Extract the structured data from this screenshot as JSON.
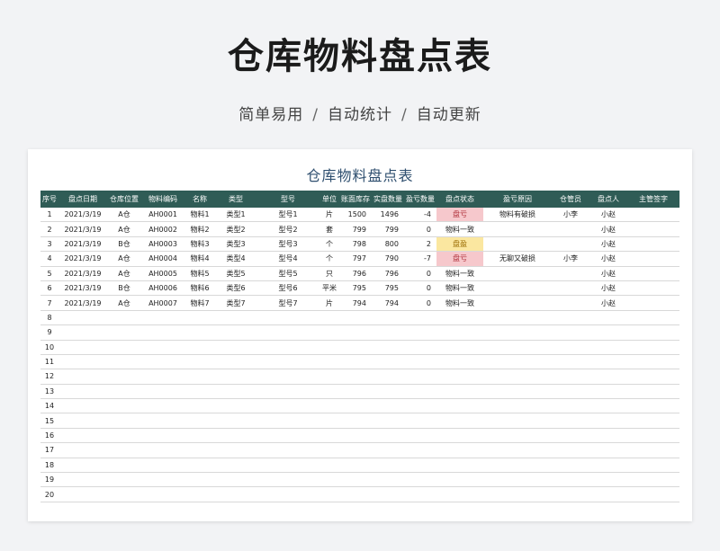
{
  "hero": {
    "title": "仓库物料盘点表",
    "subtitle_parts": [
      "简单易用",
      "自动统计",
      "自动更新"
    ],
    "separator": "/"
  },
  "sheet": {
    "title": "仓库物料盘点表",
    "header_color": "#2f5c56",
    "columns": [
      "序号",
      "盘点日期",
      "仓库位置",
      "物料编码",
      "名称",
      "类型",
      "型号",
      "单位",
      "账面库存",
      "实盘数量",
      "盈亏数量",
      "盘点状态",
      "盈亏原因",
      "仓管员",
      "盘点人",
      "主管签字"
    ],
    "rows": [
      {
        "seq": "1",
        "date": "2021/3/19",
        "location": "A仓",
        "code": "AH0001",
        "name": "物料1",
        "type": "类型1",
        "model": "型号1",
        "unit": "片",
        "book": "1500",
        "actual": "1496",
        "diff": "-4",
        "status": "盘亏",
        "status_kind": "loss",
        "reason": "物料有破损",
        "keeper": "小李",
        "checker": "小赵",
        "supervisor": ""
      },
      {
        "seq": "2",
        "date": "2021/3/19",
        "location": "A仓",
        "code": "AH0002",
        "name": "物料2",
        "type": "类型2",
        "model": "型号2",
        "unit": "套",
        "book": "799",
        "actual": "799",
        "diff": "0",
        "status": "物料一致",
        "status_kind": "ok",
        "reason": "",
        "keeper": "",
        "checker": "小赵",
        "supervisor": ""
      },
      {
        "seq": "3",
        "date": "2021/3/19",
        "location": "B仓",
        "code": "AH0003",
        "name": "物料3",
        "type": "类型3",
        "model": "型号3",
        "unit": "个",
        "book": "798",
        "actual": "800",
        "diff": "2",
        "status": "盘盈",
        "status_kind": "gain",
        "reason": "",
        "keeper": "",
        "checker": "小赵",
        "supervisor": ""
      },
      {
        "seq": "4",
        "date": "2021/3/19",
        "location": "A仓",
        "code": "AH0004",
        "name": "物料4",
        "type": "类型4",
        "model": "型号4",
        "unit": "个",
        "book": "797",
        "actual": "790",
        "diff": "-7",
        "status": "盘亏",
        "status_kind": "loss",
        "reason": "无聊又破损",
        "keeper": "小李",
        "checker": "小赵",
        "supervisor": ""
      },
      {
        "seq": "5",
        "date": "2021/3/19",
        "location": "A仓",
        "code": "AH0005",
        "name": "物料5",
        "type": "类型5",
        "model": "型号5",
        "unit": "只",
        "book": "796",
        "actual": "796",
        "diff": "0",
        "status": "物料一致",
        "status_kind": "ok",
        "reason": "",
        "keeper": "",
        "checker": "小赵",
        "supervisor": ""
      },
      {
        "seq": "6",
        "date": "2021/3/19",
        "location": "B仓",
        "code": "AH0006",
        "name": "物料6",
        "type": "类型6",
        "model": "型号6",
        "unit": "平米",
        "book": "795",
        "actual": "795",
        "diff": "0",
        "status": "物料一致",
        "status_kind": "ok",
        "reason": "",
        "keeper": "",
        "checker": "小赵",
        "supervisor": ""
      },
      {
        "seq": "7",
        "date": "2021/3/19",
        "location": "A仓",
        "code": "AH0007",
        "name": "物料7",
        "type": "类型7",
        "model": "型号7",
        "unit": "片",
        "book": "794",
        "actual": "794",
        "diff": "0",
        "status": "物料一致",
        "status_kind": "ok",
        "reason": "",
        "keeper": "",
        "checker": "小赵",
        "supervisor": ""
      }
    ],
    "empty_rows": [
      "8",
      "9",
      "10",
      "11",
      "12",
      "13",
      "14",
      "15",
      "16",
      "17",
      "18",
      "19",
      "20"
    ]
  }
}
